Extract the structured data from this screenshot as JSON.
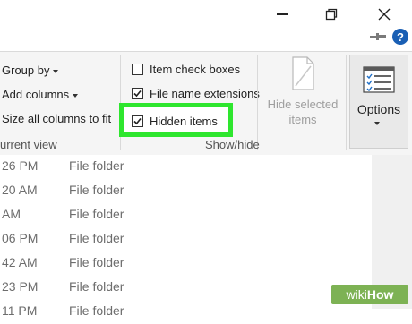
{
  "window": {
    "minimize_icon": "minimize-icon",
    "maximize_icon": "restore-icon",
    "close_icon": "close-icon"
  },
  "ribbon_helpers": {
    "pin_icon": "pin-icon",
    "help_label": "?"
  },
  "layout_group": {
    "group_by": "Group by",
    "add_columns": "Add columns",
    "size_all_columns": "Size all columns to fit",
    "group_label": "urrent view"
  },
  "show_hide": {
    "items": [
      {
        "label": "Item check boxes",
        "checked": false
      },
      {
        "label": "File name extensions",
        "checked": true
      },
      {
        "label": "Hidden items",
        "checked": true
      }
    ],
    "hide_selected_line1": "Hide selected",
    "hide_selected_line2": "items",
    "group_label": "Show/hide",
    "highlight_color": "#2ee62e"
  },
  "options": {
    "label": "Options"
  },
  "file_rows": [
    {
      "time": "26 PM",
      "type": "File folder"
    },
    {
      "time": "20 AM",
      "type": "File folder"
    },
    {
      "time": " AM",
      "type": "File folder"
    },
    {
      "time": "06 PM",
      "type": "File folder"
    },
    {
      "time": "42 AM",
      "type": "File folder"
    },
    {
      "time": "23 PM",
      "type": "File folder"
    },
    {
      "time": "11 PM",
      "type": "File folder"
    }
  ],
  "watermark": {
    "wiki": "wiki",
    "how": "How",
    "color": "#7db254"
  }
}
